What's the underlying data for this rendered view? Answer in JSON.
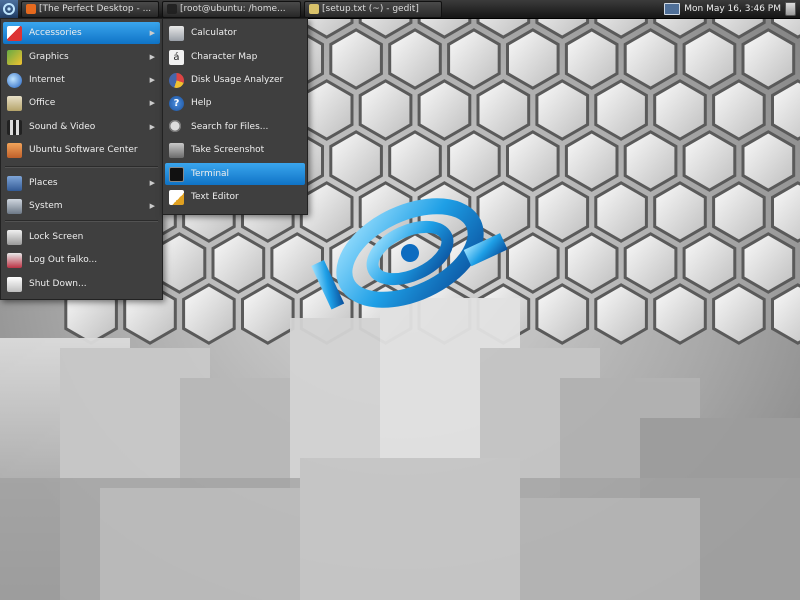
{
  "top_panel": {
    "tasks": [
      {
        "label": "[The Perfect Desktop - ...",
        "icon": "firefox-icon",
        "color": "#e66a1f"
      },
      {
        "label": "[root@ubuntu: /home...",
        "icon": "terminal-icon",
        "color": "#222222"
      },
      {
        "label": "[setup.txt (~) - gedit]",
        "icon": "text-editor-icon",
        "color": "#d9c26a"
      }
    ],
    "clock": "Mon May 16,  3:46 PM"
  },
  "main_menu": {
    "items": [
      {
        "label": "Accessories",
        "icon": "accessories-icon",
        "has_submenu": true
      },
      {
        "label": "Graphics",
        "icon": "graphics-icon",
        "has_submenu": true
      },
      {
        "label": "Internet",
        "icon": "internet-icon",
        "has_submenu": true
      },
      {
        "label": "Office",
        "icon": "office-icon",
        "has_submenu": true
      },
      {
        "label": "Sound & Video",
        "icon": "sound-video-icon",
        "has_submenu": true
      },
      {
        "label": "Ubuntu Software Center",
        "icon": "software-center-icon",
        "has_submenu": false
      },
      {
        "label": "Places",
        "icon": "places-icon",
        "has_submenu": true
      },
      {
        "label": "System",
        "icon": "system-icon",
        "has_submenu": true
      },
      {
        "label": "Lock Screen",
        "icon": "lock-icon",
        "has_submenu": false
      },
      {
        "label": "Log Out falko...",
        "icon": "logout-icon",
        "has_submenu": false
      },
      {
        "label": "Shut Down...",
        "icon": "shutdown-icon",
        "has_submenu": false
      }
    ]
  },
  "accessories_menu": {
    "items": [
      {
        "label": "Calculator",
        "icon": "calculator-icon"
      },
      {
        "label": "Character Map",
        "icon": "character-map-icon"
      },
      {
        "label": "Disk Usage Analyzer",
        "icon": "disk-usage-icon"
      },
      {
        "label": "Help",
        "icon": "help-icon"
      },
      {
        "label": "Search for Files...",
        "icon": "search-icon"
      },
      {
        "label": "Take Screenshot",
        "icon": "screenshot-icon"
      },
      {
        "label": "Terminal",
        "icon": "terminal-icon"
      },
      {
        "label": "Text Editor",
        "icon": "text-editor-icon"
      }
    ]
  },
  "colors": {
    "selection": "#1a85d6",
    "menu_bg": "#3f3f3f",
    "logo": "#1e9fe6"
  }
}
